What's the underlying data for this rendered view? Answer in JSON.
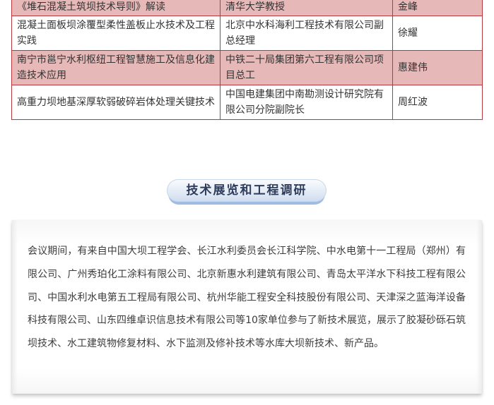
{
  "table": {
    "rows": [
      {
        "topic": "《堆石混凝土筑坝技术导则》解读",
        "organization": "清华大学教授",
        "speaker": "金峰"
      },
      {
        "topic": "混凝土面板坝涂覆型柔性盖板止水技术及工程实践",
        "organization": "北京中水科海利工程技术有限公司副总经理",
        "speaker": "徐耀"
      },
      {
        "topic": "南宁市邕宁水利枢纽工程智慧施工及信息化建造技术应用",
        "organization": "中铁二十局集团第六工程有限公司项目总工",
        "speaker": "惠建伟"
      },
      {
        "topic": "高重力坝地基深厚软弱破碎岩体处理关键技术",
        "organization": "中国电建集团中南勘测设计研究院有限公司分院副院长",
        "speaker": "周红波"
      }
    ]
  },
  "section": {
    "title": "技术展览和工程调研"
  },
  "card": {
    "paragraph": "会议期间，有来自中国大坝工程学会、长江水利委员会长江科学院、中水电第十一工程局（郑州）有限公司、广州秀珀化工涂料有限公司、北京新惠水利建筑有限公司、青岛太平洋水下科技工程有限公司、中国水利水电第五工程局有限公司、杭州华能工程安全科技股份有限公司、天津深之蓝海洋设备科技有限公司、山东四维卓识信息技术有限公司等10家单位参与了新技术展览，展示了胶凝砂砾石筑坝技术、水工建筑物修复材料、水下监测及修补技术等水库大坝新技术、新产品。"
  },
  "colors": {
    "table_border": "#b4383d",
    "shaded_row": "#e6b9b8",
    "pill_text": "#2f3d5c",
    "pill_shadow": "#9fbde3"
  }
}
